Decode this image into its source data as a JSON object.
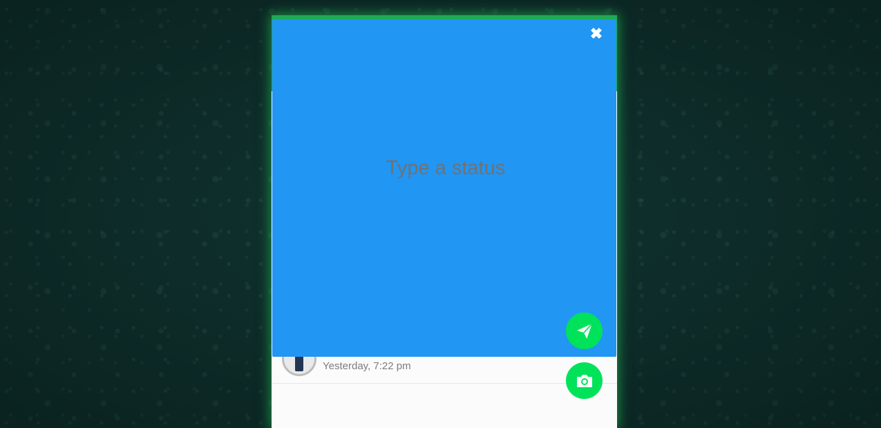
{
  "status_list": {
    "time": "Yesterday, 7:22 pm"
  },
  "composer": {
    "placeholder": "Type a status",
    "close_icon": "close-icon",
    "background_color": "#2196f3"
  },
  "actions": {
    "send_icon": "paper-plane-icon",
    "camera_icon": "camera-icon",
    "accent_color": "#00e25a"
  }
}
